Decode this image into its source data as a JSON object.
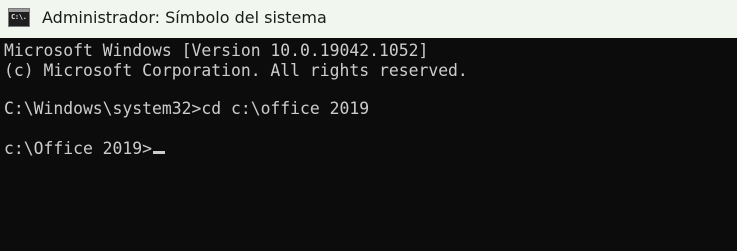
{
  "window": {
    "title": "Administrador: Símbolo del sistema",
    "icon": "C:\\."
  },
  "console": {
    "lines": [
      "Microsoft Windows [Version 10.0.19042.1052]",
      "(c) Microsoft Corporation. All rights reserved.",
      "C:\\Windows\\system32>cd c:\\office 2019",
      "c:\\Office 2019>"
    ]
  },
  "colors": {
    "titlebar_bg": "#f1f7ee",
    "console_bg": "#0c0c0c",
    "console_text": "#cccccc"
  }
}
